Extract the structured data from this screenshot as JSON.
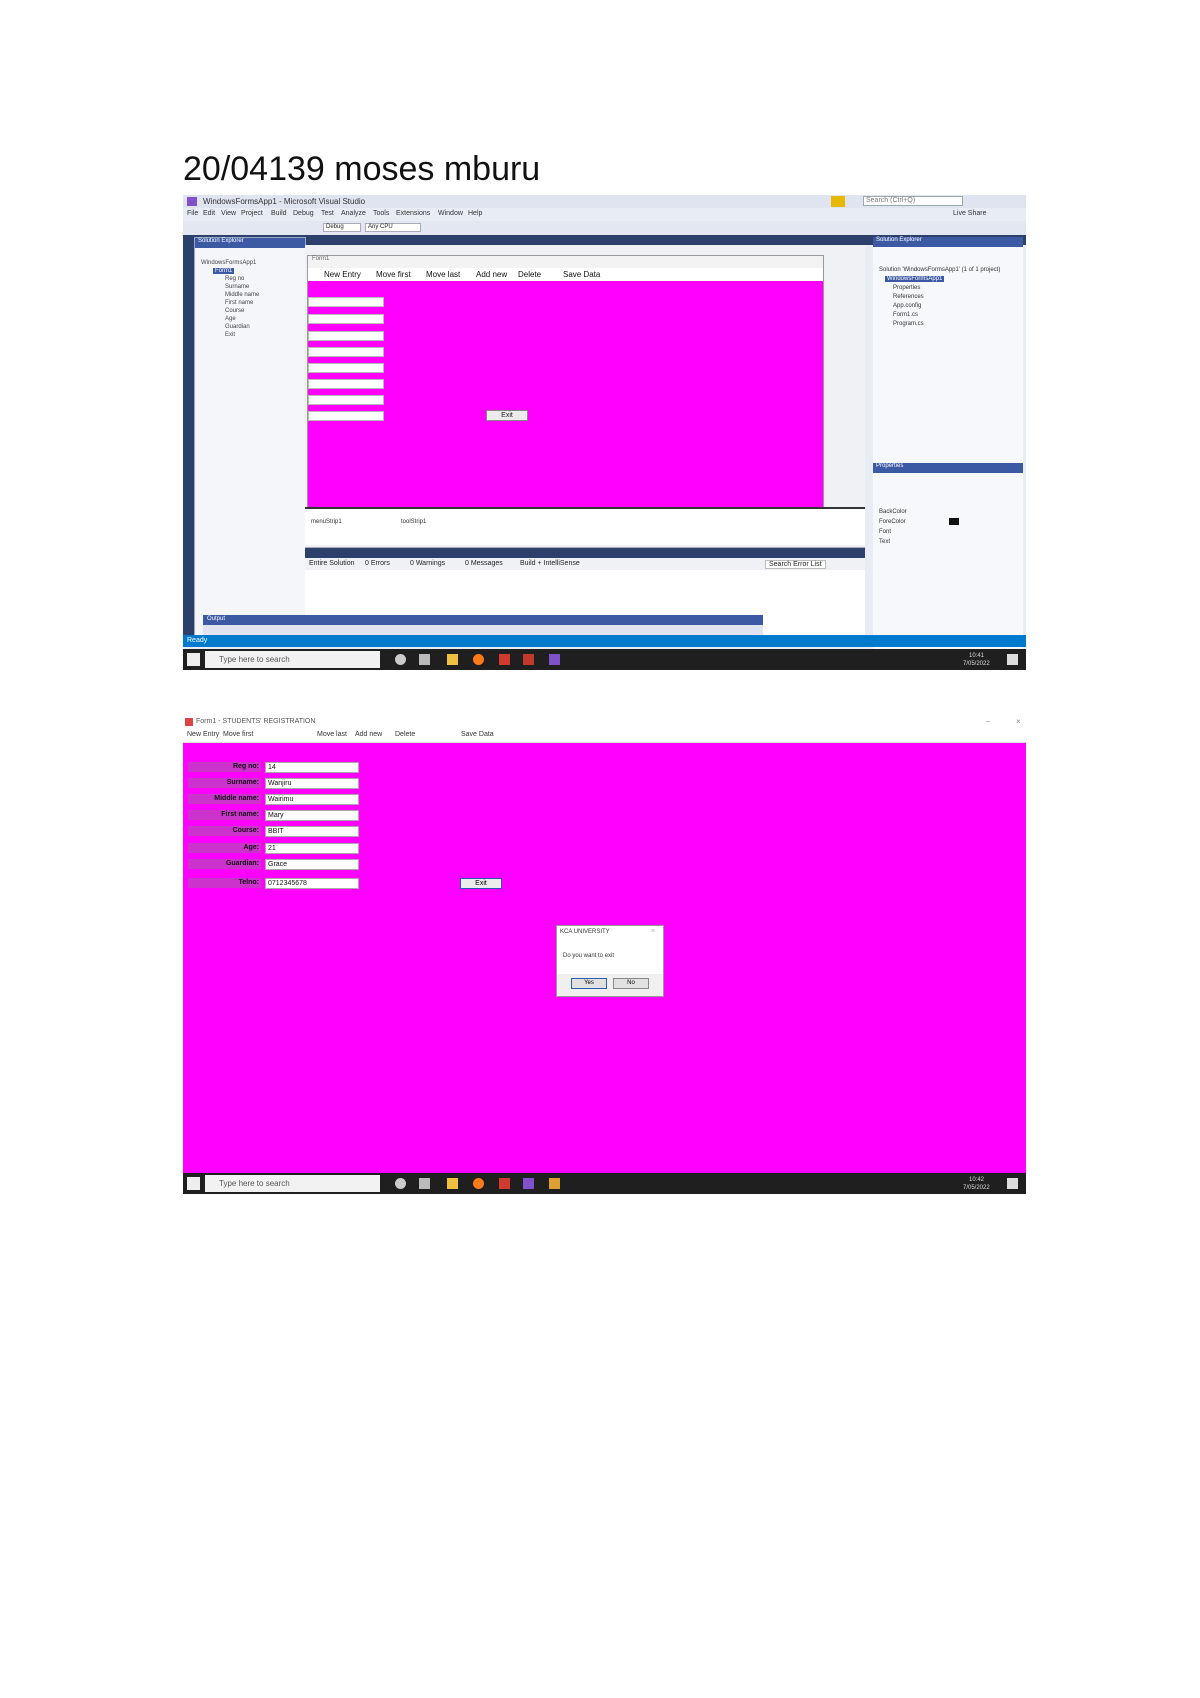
{
  "document": {
    "title": "20/04139 moses mburu"
  },
  "vs": {
    "title": "WindowsFormsApp1 - Microsoft Visual Studio",
    "search_placeholder": "Search (Ctrl+Q)",
    "liveshare": "Live Share",
    "menu": [
      "File",
      "Edit",
      "View",
      "Project",
      "Build",
      "Debug",
      "Test",
      "Analyze",
      "Tools",
      "Extensions",
      "Window",
      "Help"
    ],
    "config": "Debug",
    "platform": "Any CPU",
    "solution_explorer_title": "Solution Explorer",
    "tree": [
      "WindowsFormsApp1",
      "Form1",
      "Reg no",
      "Surname",
      "Middle name",
      "First name",
      "Course",
      "Age",
      "Guardian",
      "Exit"
    ],
    "form_caption": "Form1",
    "form_menu": [
      "New Entry",
      "Move first",
      "Move last",
      "Add new",
      "Delete",
      "Save Data"
    ],
    "exit_label": "Exit",
    "tray_items": [
      "menuStrip1",
      "toolStrip1"
    ],
    "output_tabs": [
      "Entire Solution",
      "0 Errors",
      "0 Warnings",
      "0 Messages",
      "Build + IntelliSense"
    ],
    "search_error_list": "Search Error List",
    "errorbar_title": "Output",
    "right_panel_title": "Solution Explorer",
    "right_tree": [
      "Solution 'WindowsFormsApp1' (1 of 1 project)",
      "WindowsFormsApp1",
      "Properties",
      "References",
      "App.config",
      "Form1.cs",
      "Program.cs"
    ],
    "properties_title": "Properties",
    "properties_rows": [
      "BackColor",
      "ForeColor",
      "Font",
      "Text"
    ],
    "status": "Ready",
    "taskbar_search": "Type here to search",
    "time": "10:41",
    "date": "7/05/2022"
  },
  "app": {
    "title": "Form1 - STUDENTS' REGISTRATION",
    "menu": [
      "New Entry",
      "Move first",
      "Move last",
      "Add new",
      "Delete",
      "Save Data"
    ],
    "fields": [
      {
        "label": "Reg no:",
        "value": "14"
      },
      {
        "label": "Surname:",
        "value": "Wanjiru"
      },
      {
        "label": "Middle name:",
        "value": "Wairimu"
      },
      {
        "label": "First name:",
        "value": "Mary"
      },
      {
        "label": "Course:",
        "value": "BBIT"
      },
      {
        "label": "Age:",
        "value": "21"
      },
      {
        "label": "Guardian:",
        "value": "Grace"
      },
      {
        "label": "Telno:",
        "value": "0712345678"
      }
    ],
    "exit_label": "Exit",
    "dialog": {
      "title": "KCA UNIVERSITY",
      "message": "Do you want to exit",
      "yes": "Yes",
      "no": "No"
    },
    "taskbar_search": "Type here to search",
    "time": "10:42",
    "date": "7/05/2022"
  }
}
